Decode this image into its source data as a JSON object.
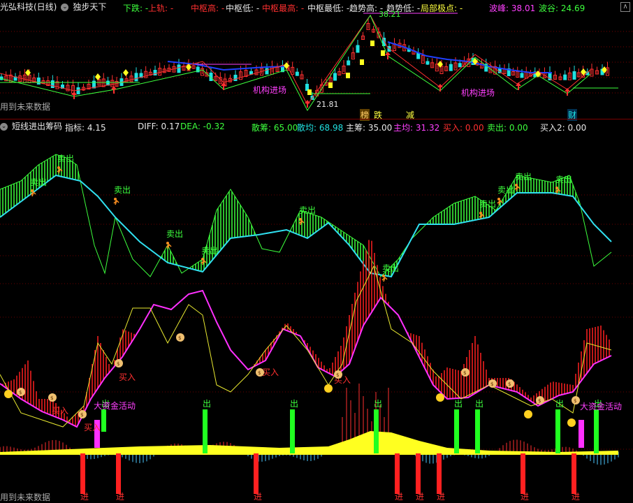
{
  "top_header": {
    "stock_name": "光弘科技(日线)",
    "indicator_name": "独步天下",
    "items": [
      {
        "label": "下跌: -",
        "color": "green"
      },
      {
        "label": "上轨: -",
        "color": "red"
      },
      {
        "label": "中枢高: -",
        "color": "red"
      },
      {
        "label": "中枢低: -",
        "color": "white"
      },
      {
        "label": "中枢最高: -",
        "color": "red"
      },
      {
        "label": "中枢最低: -",
        "color": "white"
      },
      {
        "label": "趋势高: -",
        "color": "white"
      },
      {
        "label": "趋势低: -",
        "color": "white"
      },
      {
        "label": "局部极点: -",
        "color": "yellow"
      },
      {
        "label": "波峰: 38.01",
        "color": "magenta"
      },
      {
        "label": "波谷: 24.69",
        "color": "green"
      }
    ]
  },
  "main_chart": {
    "price_high_label": "38.21",
    "price_low_label": "21.81",
    "future_data_note": "用到未来数据",
    "inst_entry_label_1": "机构进场",
    "inst_entry_label_2": "机构进场",
    "tag_bang": "榜",
    "tag_die": "跌",
    "tag_jian": "减",
    "tag_cai": "财",
    "high_low_colors": {
      "up": "#ff3030",
      "down": "#20e0e0",
      "yellow": "#ffff20"
    }
  },
  "sub_header": {
    "indicator_name": "短线进出筹码",
    "items": [
      {
        "label": "指标: 4.15",
        "color": "white"
      },
      {
        "label": "DIFF: 0.17",
        "color": "white"
      },
      {
        "label": "DEA: -0.32",
        "color": "green"
      },
      {
        "label": "散筹: 65.00",
        "color": "green"
      },
      {
        "label": "散均: 68.98",
        "color": "cyan"
      },
      {
        "label": "主筹: 35.00",
        "color": "white"
      },
      {
        "label": "主均: 31.32",
        "color": "magenta"
      },
      {
        "label": "买入: 0.00",
        "color": "red"
      },
      {
        "label": "卖出: 0.00",
        "color": "green"
      },
      {
        "label": "买入2: 0.00",
        "color": "white"
      }
    ]
  },
  "sub_chart": {
    "sell_label": "卖出",
    "buy_label": "买入",
    "big_fund_label": "大资金活动",
    "out_label": "出",
    "in_label": "进",
    "future_data_note": "用到未来数据"
  }
}
